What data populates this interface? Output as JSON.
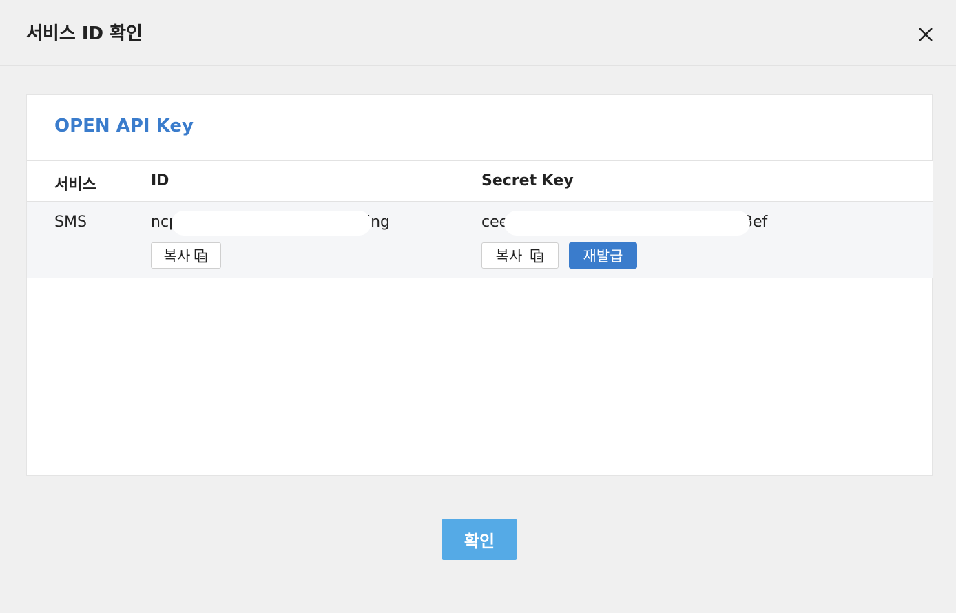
{
  "header": {
    "title": "서비스 ID 확인",
    "close_icon": "close-icon"
  },
  "card": {
    "title": "OPEN API Key",
    "columns": [
      "서비스",
      "ID",
      "Secret Key"
    ],
    "rows": [
      {
        "service": "SMS",
        "id_prefix": "ncp",
        "id_suffix": "ing",
        "secret_prefix": "cee",
        "secret_suffix": "3ef",
        "copy_label": "복사",
        "reissue_label": "재발급"
      }
    ]
  },
  "footer": {
    "confirm_label": "확인"
  },
  "colors": {
    "accent": "#3a7ccc",
    "confirm": "#55aae6",
    "background": "#f0f0f0"
  }
}
